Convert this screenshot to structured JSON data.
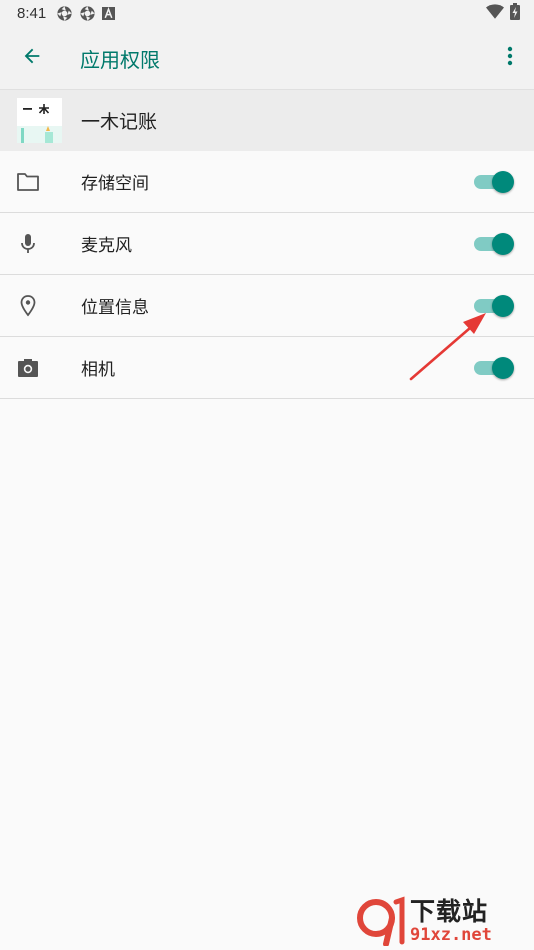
{
  "status_bar": {
    "time": "8:41",
    "icons": [
      "aperture-icon",
      "aperture-icon",
      "font-a-icon"
    ],
    "right_icons": [
      "wifi-icon",
      "battery-charging-icon"
    ]
  },
  "toolbar": {
    "title": "应用权限",
    "back_icon": "arrow-back-icon",
    "overflow_icon": "more-vert-icon"
  },
  "app": {
    "name": "一木记账",
    "icon_text": "一 木"
  },
  "permissions": [
    {
      "label": "存储空间",
      "icon": "folder-icon",
      "enabled": true
    },
    {
      "label": "麦克风",
      "icon": "microphone-icon",
      "enabled": true
    },
    {
      "label": "位置信息",
      "icon": "location-pin-icon",
      "enabled": true
    },
    {
      "label": "相机",
      "icon": "camera-icon",
      "enabled": true
    }
  ],
  "watermark": {
    "cn": "下载站",
    "en": "91xz.net",
    "logo_text": "9"
  },
  "colors": {
    "accent": "#00796b",
    "switch_thumb": "#00897b",
    "switch_track": "#80cbc4",
    "annotation": "#e53935"
  }
}
